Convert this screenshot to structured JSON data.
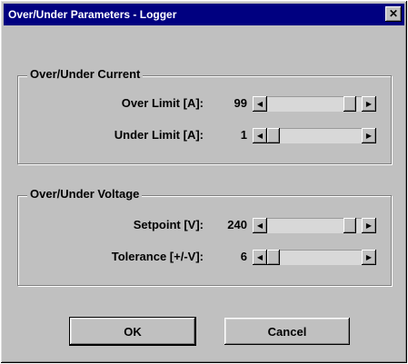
{
  "window": {
    "title": "Over/Under Parameters - Logger",
    "close_glyph": "✕"
  },
  "current_group": {
    "title": "Over/Under Current",
    "rows": [
      {
        "label": "Over Limit [A]:",
        "value": "99",
        "slider_fraction": 0.93
      },
      {
        "label": "Under Limit [A]:",
        "value": "1",
        "slider_fraction": 0.0
      }
    ]
  },
  "voltage_group": {
    "title": "Over/Under Voltage",
    "rows": [
      {
        "label": "Setpoint [V]:",
        "value": "240",
        "slider_fraction": 0.93
      },
      {
        "label": "Tolerance [+/-V]:",
        "value": "6",
        "slider_fraction": 0.0
      }
    ]
  },
  "buttons": {
    "ok_label": "OK",
    "cancel_label": "Cancel"
  },
  "icons": {
    "scroll_left": "◀",
    "scroll_right": "▶"
  }
}
